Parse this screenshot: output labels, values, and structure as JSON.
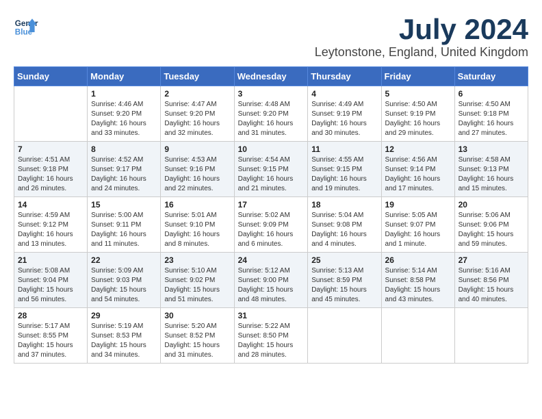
{
  "logo": {
    "line1": "General",
    "line2": "Blue"
  },
  "title": "July 2024",
  "location": "Leytonstone, England, United Kingdom",
  "days_of_week": [
    "Sunday",
    "Monday",
    "Tuesday",
    "Wednesday",
    "Thursday",
    "Friday",
    "Saturday"
  ],
  "weeks": [
    [
      {
        "day": "",
        "info": ""
      },
      {
        "day": "1",
        "info": "Sunrise: 4:46 AM\nSunset: 9:20 PM\nDaylight: 16 hours\nand 33 minutes."
      },
      {
        "day": "2",
        "info": "Sunrise: 4:47 AM\nSunset: 9:20 PM\nDaylight: 16 hours\nand 32 minutes."
      },
      {
        "day": "3",
        "info": "Sunrise: 4:48 AM\nSunset: 9:20 PM\nDaylight: 16 hours\nand 31 minutes."
      },
      {
        "day": "4",
        "info": "Sunrise: 4:49 AM\nSunset: 9:19 PM\nDaylight: 16 hours\nand 30 minutes."
      },
      {
        "day": "5",
        "info": "Sunrise: 4:50 AM\nSunset: 9:19 PM\nDaylight: 16 hours\nand 29 minutes."
      },
      {
        "day": "6",
        "info": "Sunrise: 4:50 AM\nSunset: 9:18 PM\nDaylight: 16 hours\nand 27 minutes."
      }
    ],
    [
      {
        "day": "7",
        "info": "Sunrise: 4:51 AM\nSunset: 9:18 PM\nDaylight: 16 hours\nand 26 minutes."
      },
      {
        "day": "8",
        "info": "Sunrise: 4:52 AM\nSunset: 9:17 PM\nDaylight: 16 hours\nand 24 minutes."
      },
      {
        "day": "9",
        "info": "Sunrise: 4:53 AM\nSunset: 9:16 PM\nDaylight: 16 hours\nand 22 minutes."
      },
      {
        "day": "10",
        "info": "Sunrise: 4:54 AM\nSunset: 9:15 PM\nDaylight: 16 hours\nand 21 minutes."
      },
      {
        "day": "11",
        "info": "Sunrise: 4:55 AM\nSunset: 9:15 PM\nDaylight: 16 hours\nand 19 minutes."
      },
      {
        "day": "12",
        "info": "Sunrise: 4:56 AM\nSunset: 9:14 PM\nDaylight: 16 hours\nand 17 minutes."
      },
      {
        "day": "13",
        "info": "Sunrise: 4:58 AM\nSunset: 9:13 PM\nDaylight: 16 hours\nand 15 minutes."
      }
    ],
    [
      {
        "day": "14",
        "info": "Sunrise: 4:59 AM\nSunset: 9:12 PM\nDaylight: 16 hours\nand 13 minutes."
      },
      {
        "day": "15",
        "info": "Sunrise: 5:00 AM\nSunset: 9:11 PM\nDaylight: 16 hours\nand 11 minutes."
      },
      {
        "day": "16",
        "info": "Sunrise: 5:01 AM\nSunset: 9:10 PM\nDaylight: 16 hours\nand 8 minutes."
      },
      {
        "day": "17",
        "info": "Sunrise: 5:02 AM\nSunset: 9:09 PM\nDaylight: 16 hours\nand 6 minutes."
      },
      {
        "day": "18",
        "info": "Sunrise: 5:04 AM\nSunset: 9:08 PM\nDaylight: 16 hours\nand 4 minutes."
      },
      {
        "day": "19",
        "info": "Sunrise: 5:05 AM\nSunset: 9:07 PM\nDaylight: 16 hours\nand 1 minute."
      },
      {
        "day": "20",
        "info": "Sunrise: 5:06 AM\nSunset: 9:06 PM\nDaylight: 15 hours\nand 59 minutes."
      }
    ],
    [
      {
        "day": "21",
        "info": "Sunrise: 5:08 AM\nSunset: 9:04 PM\nDaylight: 15 hours\nand 56 minutes."
      },
      {
        "day": "22",
        "info": "Sunrise: 5:09 AM\nSunset: 9:03 PM\nDaylight: 15 hours\nand 54 minutes."
      },
      {
        "day": "23",
        "info": "Sunrise: 5:10 AM\nSunset: 9:02 PM\nDaylight: 15 hours\nand 51 minutes."
      },
      {
        "day": "24",
        "info": "Sunrise: 5:12 AM\nSunset: 9:00 PM\nDaylight: 15 hours\nand 48 minutes."
      },
      {
        "day": "25",
        "info": "Sunrise: 5:13 AM\nSunset: 8:59 PM\nDaylight: 15 hours\nand 45 minutes."
      },
      {
        "day": "26",
        "info": "Sunrise: 5:14 AM\nSunset: 8:58 PM\nDaylight: 15 hours\nand 43 minutes."
      },
      {
        "day": "27",
        "info": "Sunrise: 5:16 AM\nSunset: 8:56 PM\nDaylight: 15 hours\nand 40 minutes."
      }
    ],
    [
      {
        "day": "28",
        "info": "Sunrise: 5:17 AM\nSunset: 8:55 PM\nDaylight: 15 hours\nand 37 minutes."
      },
      {
        "day": "29",
        "info": "Sunrise: 5:19 AM\nSunset: 8:53 PM\nDaylight: 15 hours\nand 34 minutes."
      },
      {
        "day": "30",
        "info": "Sunrise: 5:20 AM\nSunset: 8:52 PM\nDaylight: 15 hours\nand 31 minutes."
      },
      {
        "day": "31",
        "info": "Sunrise: 5:22 AM\nSunset: 8:50 PM\nDaylight: 15 hours\nand 28 minutes."
      },
      {
        "day": "",
        "info": ""
      },
      {
        "day": "",
        "info": ""
      },
      {
        "day": "",
        "info": ""
      }
    ]
  ]
}
